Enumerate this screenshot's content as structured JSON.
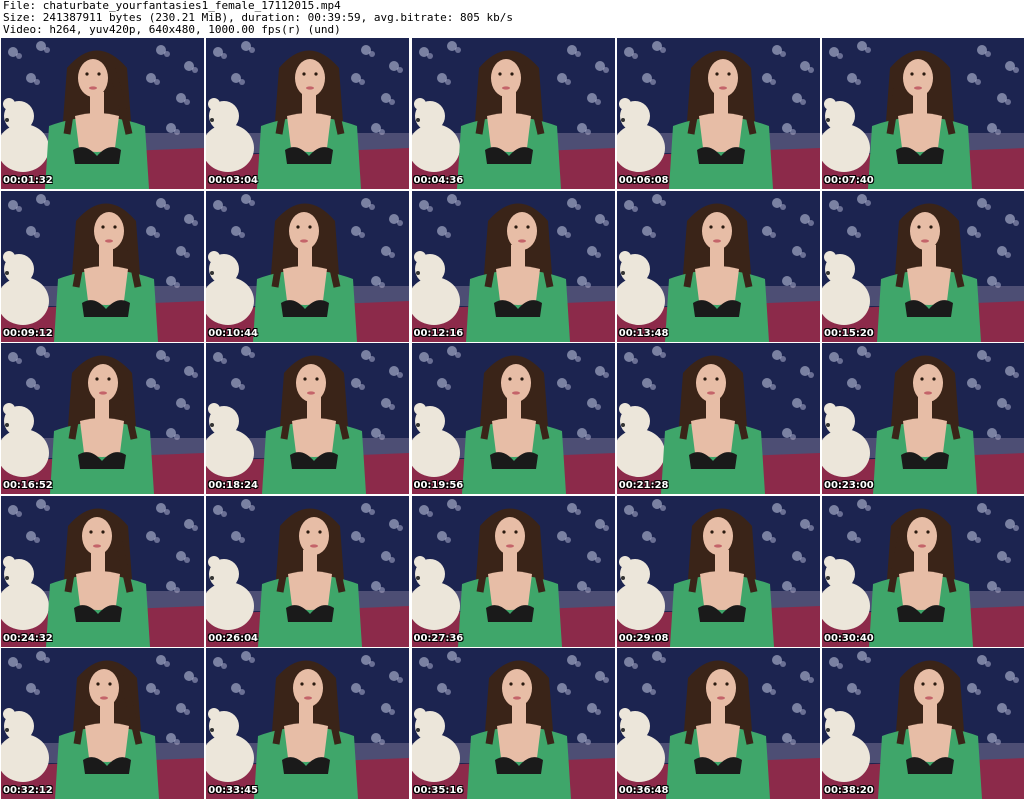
{
  "header": {
    "file_line": "File: chaturbate_yourfantasies1_female_17112015.mp4",
    "size_line": "Size: 241387911 bytes (230.21 MiB), duration: 00:39:59, avg.bitrate: 805 kb/s",
    "video_line": "Video: h264, yuv420p, 640x480, 1000.00 fps(r) (und)"
  },
  "thumbnails": [
    {
      "timestamp": "00:01:32"
    },
    {
      "timestamp": "00:03:04"
    },
    {
      "timestamp": "00:04:36"
    },
    {
      "timestamp": "00:06:08"
    },
    {
      "timestamp": "00:07:40"
    },
    {
      "timestamp": "00:09:12"
    },
    {
      "timestamp": "00:10:44"
    },
    {
      "timestamp": "00:12:16"
    },
    {
      "timestamp": "00:13:48"
    },
    {
      "timestamp": "00:15:20"
    },
    {
      "timestamp": "00:16:52"
    },
    {
      "timestamp": "00:18:24"
    },
    {
      "timestamp": "00:19:56"
    },
    {
      "timestamp": "00:21:28"
    },
    {
      "timestamp": "00:23:00"
    },
    {
      "timestamp": "00:24:32"
    },
    {
      "timestamp": "00:26:04"
    },
    {
      "timestamp": "00:27:36"
    },
    {
      "timestamp": "00:29:08"
    },
    {
      "timestamp": "00:30:40"
    },
    {
      "timestamp": "00:32:12"
    },
    {
      "timestamp": "00:33:45"
    },
    {
      "timestamp": "00:35:16"
    },
    {
      "timestamp": "00:36:48"
    },
    {
      "timestamp": "00:38:20"
    }
  ],
  "colors": {
    "background": "#ffffff",
    "wallpaper": "#1c2450",
    "wallpaper_flower": "#c9cde6",
    "teddy_bear": "#ece6da",
    "bedspread": "#8c2a4a",
    "shirt": "#3fa66a",
    "skin": "#e7bda6",
    "hair": "#3a2418",
    "bra": "#1a1a1a"
  }
}
